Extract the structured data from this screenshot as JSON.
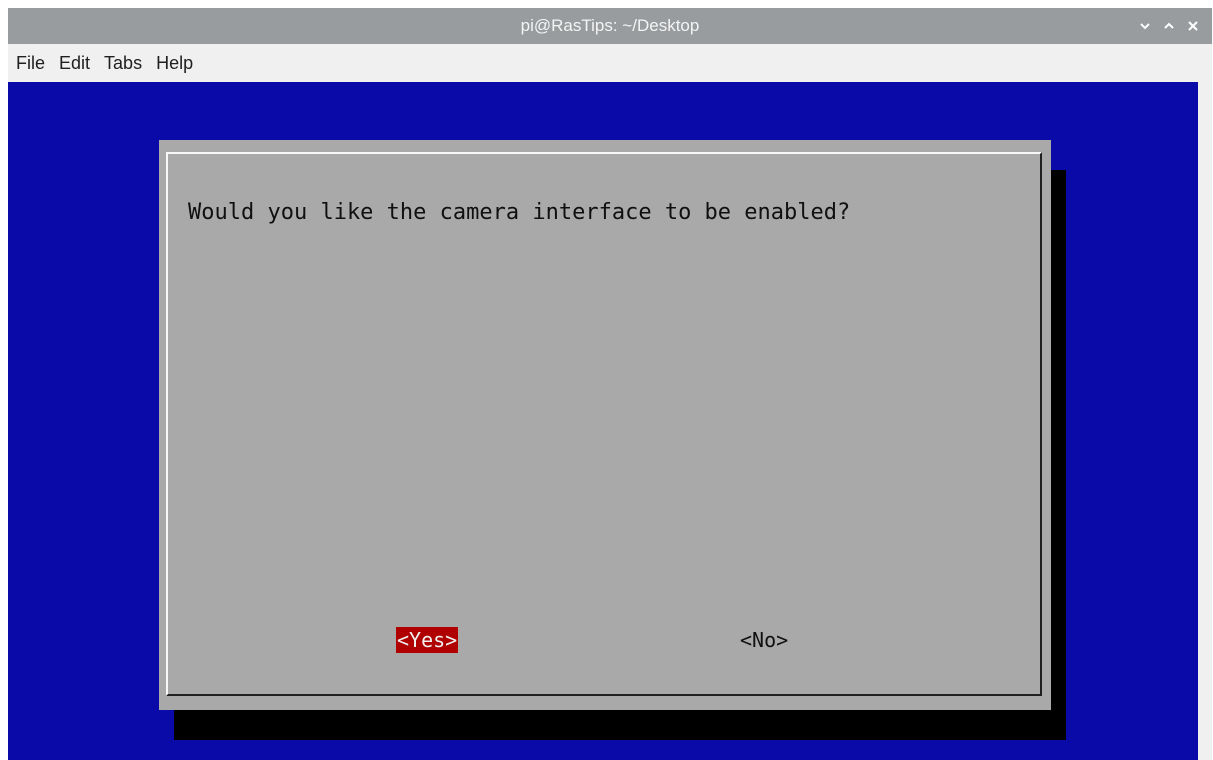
{
  "window": {
    "title": "pi@RasTips: ~/Desktop"
  },
  "menubar": {
    "items": [
      "File",
      "Edit",
      "Tabs",
      "Help"
    ]
  },
  "dialog": {
    "question": "Would you like the camera interface to be enabled?",
    "yes_label": "<Yes>",
    "no_label": "<No>",
    "selected": "yes"
  },
  "colors": {
    "titlebar": "#989c9e",
    "terminal_background": "#0a0aa8",
    "dialog_background": "#a9a9a9",
    "selected_button": "#b00000"
  },
  "icons": {
    "minimize": "chevron-down-icon",
    "maximize": "chevron-up-icon",
    "close": "close-icon"
  }
}
